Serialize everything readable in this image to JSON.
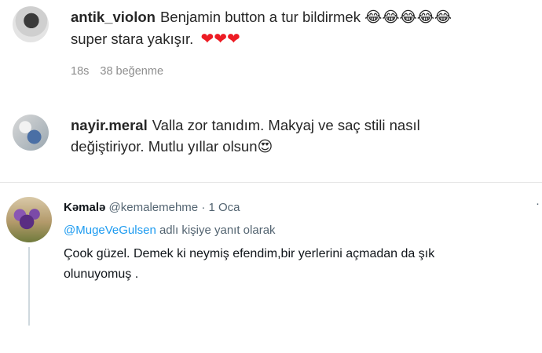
{
  "comments": [
    {
      "username": "antik_violon",
      "text": "Benjamin button a tur bildirmek",
      "emojis": "😂😂😂😂😂",
      "text2": "super stara yakışır.",
      "hearts": "❤❤❤",
      "time": "18s",
      "likes": "38 beğenme"
    },
    {
      "username": "nayir.meral",
      "text": "Valla zor tanıdım. Makyaj ve saç stili nasıl",
      "text2": "değiştiriyor. Mutlu yıllar olsun",
      "emoji": "😍"
    }
  ],
  "tweet": {
    "name": "Kəmalə",
    "handle": "@kemalemehme",
    "separator": "·",
    "date": "1 Oca",
    "more": "·",
    "reply_mention": "@MugeVeGulsen",
    "reply_suffix": "adlı kişiye yanıt olarak",
    "text": "Çook güzel. Demek ki neymiş efendim,bir yerlerini açmadan da şık olunuyomuş ."
  }
}
